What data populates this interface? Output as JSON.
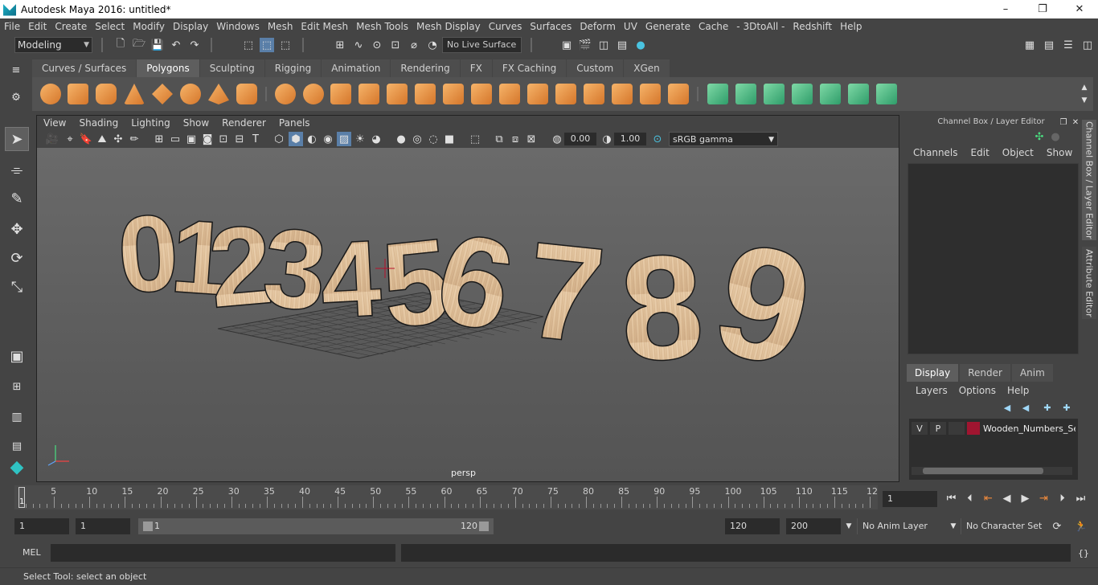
{
  "window": {
    "title": "Autodesk Maya 2016: untitled*",
    "minimize": "–",
    "restore": "❐",
    "close": "✕"
  },
  "menu": [
    "File",
    "Edit",
    "Create",
    "Select",
    "Modify",
    "Display",
    "Windows",
    "Mesh",
    "Edit Mesh",
    "Mesh Tools",
    "Mesh Display",
    "Curves",
    "Surfaces",
    "Deform",
    "UV",
    "Generate",
    "Cache",
    "- 3DtoAll -",
    "Redshift",
    "Help"
  ],
  "status_line": {
    "mode": "Modeling",
    "live_surface": "No Live Surface"
  },
  "shelf_tabs": [
    "Curves / Surfaces",
    "Polygons",
    "Sculpting",
    "Rigging",
    "Animation",
    "Rendering",
    "FX",
    "FX Caching",
    "Custom",
    "XGen"
  ],
  "active_shelf_tab": "Polygons",
  "viewport": {
    "menu": [
      "View",
      "Shading",
      "Lighting",
      "Show",
      "Renderer",
      "Panels"
    ],
    "exposure": "0.00",
    "gamma": "1.00",
    "color_space": "sRGB gamma",
    "camera_label": "persp",
    "digits": [
      "0",
      "1",
      "2",
      "3",
      "4",
      "5",
      "6",
      "7",
      "8",
      "9"
    ]
  },
  "channel_box": {
    "title": "Channel Box / Layer Editor",
    "menu": [
      "Channels",
      "Edit",
      "Object",
      "Show"
    ]
  },
  "side_tabs": [
    "Channel Box / Layer Editor",
    "Attribute Editor"
  ],
  "layer_editor": {
    "tabs": [
      "Display",
      "Render",
      "Anim"
    ],
    "active_tab": "Display",
    "menu": [
      "Layers",
      "Options",
      "Help"
    ],
    "layers": [
      {
        "visible": "V",
        "playback": "P",
        "name": "Wooden_Numbers_Set",
        "color": "#a01530"
      }
    ]
  },
  "time_slider": {
    "labels": [
      "5",
      "10",
      "15",
      "20",
      "25",
      "30",
      "35",
      "40",
      "45",
      "50",
      "55",
      "60",
      "65",
      "70",
      "75",
      "80",
      "85",
      "90",
      "95",
      "100",
      "105",
      "110",
      "115",
      "12"
    ],
    "current": "1",
    "current_frame": "1"
  },
  "range": {
    "start": "1",
    "playback_start": "1",
    "slider_start": "1",
    "slider_end": "120",
    "playback_end": "120",
    "end": "200",
    "anim_layer": "No Anim Layer",
    "character_set": "No Character Set"
  },
  "command_line": {
    "label": "MEL"
  },
  "help_line": "Select Tool: select an object"
}
